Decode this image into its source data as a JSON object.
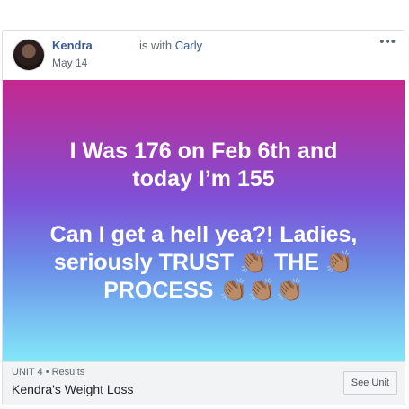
{
  "post": {
    "author": "Kendra",
    "with_text": "is with",
    "tagged_friend": "Carly",
    "date": "May 14",
    "more_label": "•••"
  },
  "banner": {
    "line1": "I Was 176 on Feb 6th and",
    "line2": "today I’m 155",
    "line3": "Can I get a hell yea?! Ladies,",
    "line4": "seriously TRUST 👏🏽 THE 👏🏽",
    "line5": "PROCESS 👏🏽👏🏽👏🏽",
    "background_top": "#c5288e",
    "background_bottom": "#82e8f8"
  },
  "footer": {
    "unit_label": "UNIT 4 • Results",
    "unit_title": "Kendra's Weight Loss",
    "see_unit_label": "See Unit"
  }
}
